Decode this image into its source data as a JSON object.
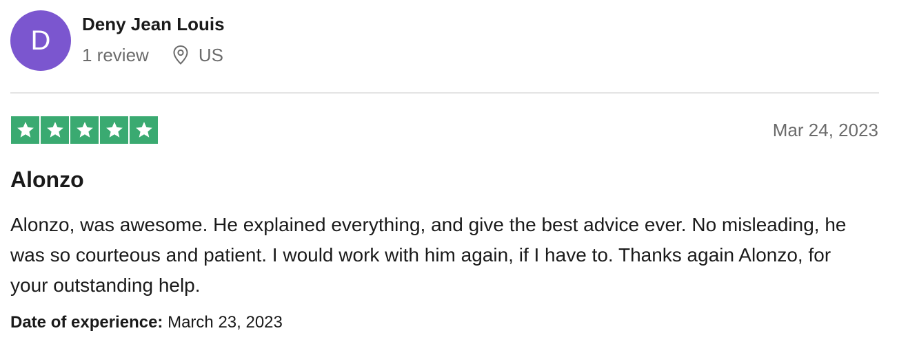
{
  "reviewer": {
    "avatar_initial": "D",
    "avatar_color": "#7b56cf",
    "name": "Deny Jean Louis",
    "review_count": "1 review",
    "location_icon": "location-pin-icon",
    "country": "US"
  },
  "review": {
    "rating": 5,
    "rating_max": 5,
    "star_color": "#3aaa71",
    "star_icon": "star-icon",
    "date": "Mar 24, 2023",
    "title": "Alonzo",
    "body": "Alonzo, was awesome. He explained everything, and give the best advice ever. No misleading, he was so courteous and patient. I would work with him again, if I have to. Thanks again Alonzo, for your outstanding help.",
    "experience_label": "Date of experience:",
    "experience_date": "March 23, 2023"
  }
}
